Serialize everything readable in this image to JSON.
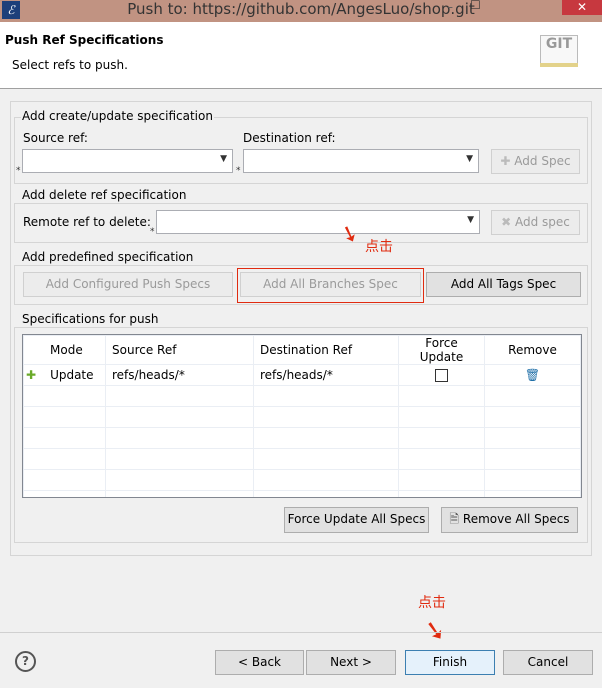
{
  "window": {
    "title": "Push to: https://github.com/AngesLuo/shop.git",
    "minimize": "–",
    "maximize": "☐",
    "close": "✕"
  },
  "header": {
    "title": "Push Ref Specifications",
    "subtitle": "Select refs to push.",
    "logo_text": "GIT"
  },
  "create_group": {
    "legend": "Add create/update specification",
    "source_label": "Source ref:",
    "source_value": "",
    "dest_label": "Destination ref:",
    "dest_value": "",
    "add_button": "Add Spec",
    "required_mark": "*"
  },
  "delete_group": {
    "legend": "Add delete ref specification",
    "remote_label": "Remote ref to delete:",
    "remote_value": "",
    "add_button": "Add spec"
  },
  "predefined_group": {
    "legend": "Add predefined specification",
    "buttons": [
      "Add Configured Push Specs",
      "Add All Branches Spec",
      "Add All Tags Spec"
    ]
  },
  "specs_group": {
    "legend": "Specifications for push",
    "columns": [
      "Mode",
      "Source Ref",
      "Destination Ref",
      "Force Update",
      "Remove"
    ],
    "rows": [
      {
        "mode": "Update",
        "source": "refs/heads/*",
        "destination": "refs/heads/*",
        "force_update": false
      }
    ],
    "force_all_button": "Force Update All Specs",
    "remove_all_button": "Remove All Specs"
  },
  "footer": {
    "help": "?",
    "back": "< Back",
    "next": "Next >",
    "finish": "Finish",
    "cancel": "Cancel"
  },
  "annotations": {
    "click1": "点击",
    "click2": "点击"
  },
  "colors": {
    "titlebar": "#c19382",
    "annotation": "#e02b10",
    "close": "#c7383f"
  }
}
